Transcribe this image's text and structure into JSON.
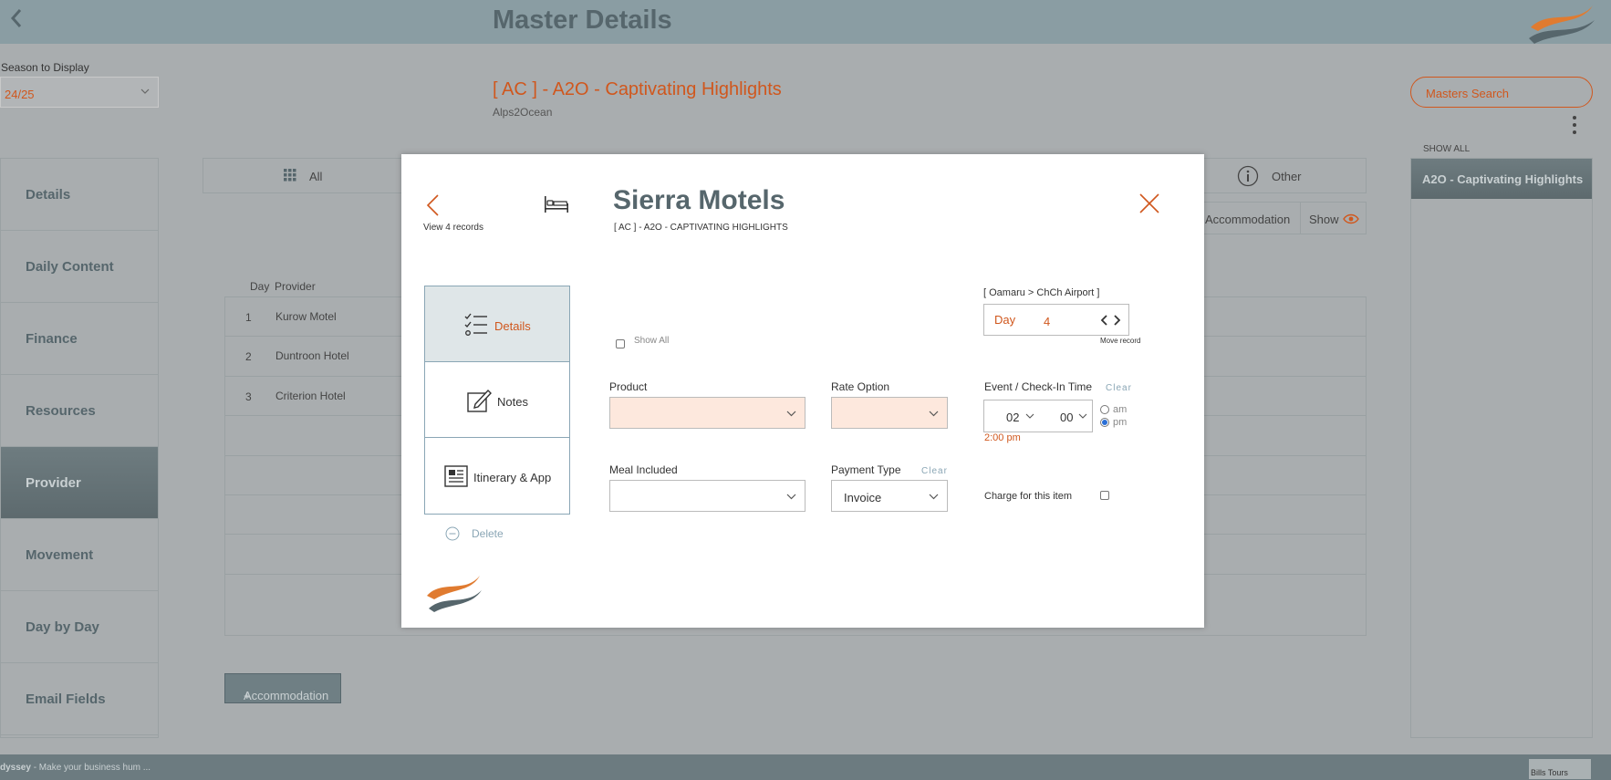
{
  "app": {
    "title": "Master Details",
    "season_label": "Season to Display",
    "season_value": "24/25",
    "master_title": "[ AC ] - A2O - Captivating Highlights",
    "master_subtitle": "Alps2Ocean",
    "masters_search": "Masters Search",
    "show_all": "SHOW ALL",
    "right_panel_item": "A2O - Captivating Highlights",
    "accent_color": "#d0571d"
  },
  "nav": [
    {
      "label": "Details"
    },
    {
      "label": "Daily Content"
    },
    {
      "label": "Finance"
    },
    {
      "label": "Resources"
    },
    {
      "label": "Provider",
      "active": true
    },
    {
      "label": "Movement"
    },
    {
      "label": "Day by Day"
    },
    {
      "label": "Email Fields"
    }
  ],
  "tabs": {
    "all": "All",
    "other": "Other"
  },
  "filter": {
    "accommodation": "Accommodation",
    "show": "Show"
  },
  "grid": {
    "headers": {
      "day": "Day",
      "provider": "Provider"
    },
    "rows": [
      {
        "day": "1",
        "provider": "Kurow Motel"
      },
      {
        "day": "2",
        "provider": "Duntroon Hotel"
      },
      {
        "day": "3",
        "provider": "Criterion Hotel"
      },
      {
        "day": "",
        "provider": ""
      },
      {
        "day": "",
        "provider": ""
      },
      {
        "day": "",
        "provider": ""
      },
      {
        "day": "",
        "provider": ""
      },
      {
        "day": "",
        "provider": ""
      }
    ]
  },
  "add_button": "Accommodation",
  "footer": {
    "brand": "dyssey",
    "tagline": " - Make your business hum ...",
    "badge": "Bills Tours"
  },
  "modal": {
    "view_records": "View 4 records",
    "title": "Sierra Motels",
    "subtitle": "[ AC ] - A2O - CAPTIVATING HIGHLIGHTS",
    "menu": [
      {
        "label": "Details",
        "active": true
      },
      {
        "label": "Notes"
      },
      {
        "label": "Itinerary & App"
      }
    ],
    "delete": "Delete",
    "show_all": "Show All",
    "route": "[ Oamaru > ChCh Airport ]",
    "day_label": "Day",
    "day_value": "4",
    "move_record": "Move record",
    "product_label": "Product",
    "product_value": "",
    "rate_option_label": "Rate Option",
    "rate_option_value": "",
    "event_label": "Event / Check-In Time",
    "clear": "Clear",
    "hour": "02",
    "minute": "00",
    "am": "am",
    "pm": "pm",
    "time_string": "2:00 pm",
    "meal_label": "Meal Included",
    "meal_value": "",
    "payment_label": "Payment Type",
    "payment_value": "Invoice",
    "charge_label": "Charge for this item"
  }
}
